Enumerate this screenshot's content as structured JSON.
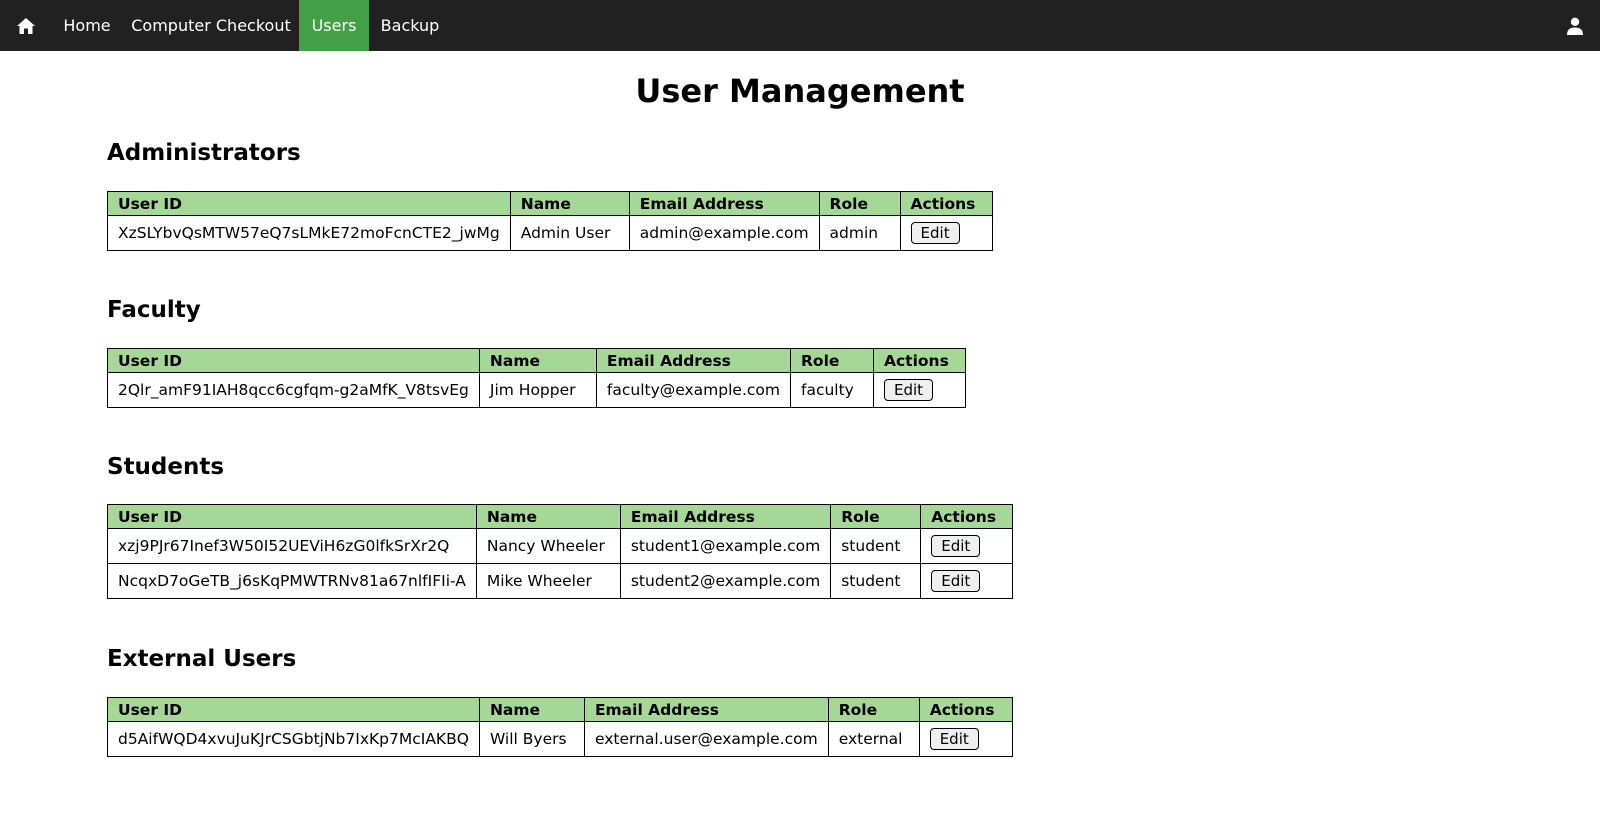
{
  "nav": {
    "home_icon": "home-icon",
    "links": [
      {
        "label": "Home"
      },
      {
        "label": "Computer Checkout"
      },
      {
        "label": "Users",
        "active": true
      },
      {
        "label": "Backup"
      }
    ],
    "user_icon": "user-icon",
    "active_color": "#43a047",
    "background": "#212121"
  },
  "page": {
    "title": "User Management"
  },
  "columns": [
    "User ID",
    "Name",
    "Email Address",
    "Role",
    "Actions"
  ],
  "header_color": "#a5d796",
  "sections": [
    {
      "title": "Administrators",
      "rows": [
        {
          "id": "XzSLYbvQsMTW57eQ7sLMkE72moFcnCTE2_jwMg",
          "name": "Admin User",
          "email": "admin@example.com",
          "role": "admin",
          "action": "Edit"
        }
      ]
    },
    {
      "title": "Faculty",
      "rows": [
        {
          "id": "2Qlr_amF91IAH8qcc6cgfqm-g2aMfK_V8tsvEg",
          "name": "Jim Hopper",
          "email": "faculty@example.com",
          "role": "faculty",
          "action": "Edit"
        }
      ]
    },
    {
      "title": "Students",
      "rows": [
        {
          "id": "xzj9PJr67Inef3W50I52UEViH6zG0lfkSrXr2Q",
          "name": "Nancy Wheeler",
          "email": "student1@example.com",
          "role": "student",
          "action": "Edit"
        },
        {
          "id": "NcqxD7oGeTB_j6sKqPMWTRNv81a67nlfIFIi-A",
          "name": "Mike Wheeler",
          "email": "student2@example.com",
          "role": "student",
          "action": "Edit"
        }
      ]
    },
    {
      "title": "External Users",
      "rows": [
        {
          "id": "d5AifWQD4xvuJuKJrCSGbtjNb7IxKp7McIAKBQ",
          "name": "Will Byers",
          "email": "external.user@example.com",
          "role": "external",
          "action": "Edit"
        }
      ]
    }
  ]
}
